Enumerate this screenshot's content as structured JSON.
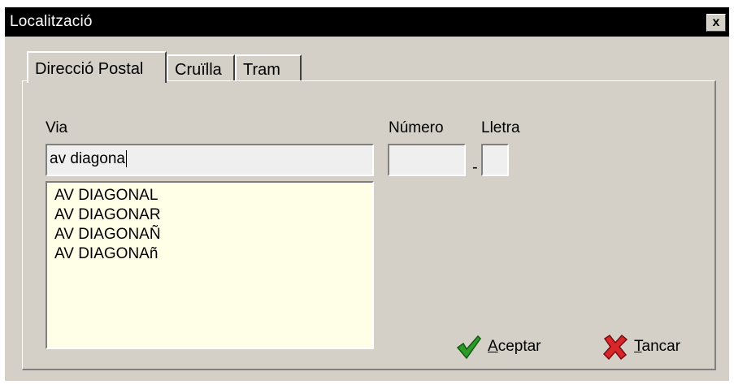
{
  "window": {
    "title": "Localització",
    "close_label": "x"
  },
  "tabs": [
    {
      "label": "Direcció Postal",
      "active": true
    },
    {
      "label": "Cruïlla",
      "active": false
    },
    {
      "label": "Tram",
      "active": false
    }
  ],
  "form": {
    "via_label": "Via",
    "via_value": "av diagona",
    "numero_label": "Número",
    "numero_value": "",
    "lletra_label": "Lletra",
    "lletra_value": "",
    "separator": "-"
  },
  "suggestions": [
    "AV DIAGONAL",
    "AV DIAGONAR",
    "AV DIAGONAÑ",
    "AV DIAGONAñ"
  ],
  "buttons": {
    "accept": {
      "accel": "A",
      "rest": "ceptar",
      "icon": "check-icon"
    },
    "close": {
      "accel": "T",
      "rest": "ancar",
      "icon": "x-icon"
    }
  },
  "colors": {
    "title_bg": "#000000",
    "dialog_bg": "#d4d0c8",
    "list_bg": "#ffffe8"
  }
}
